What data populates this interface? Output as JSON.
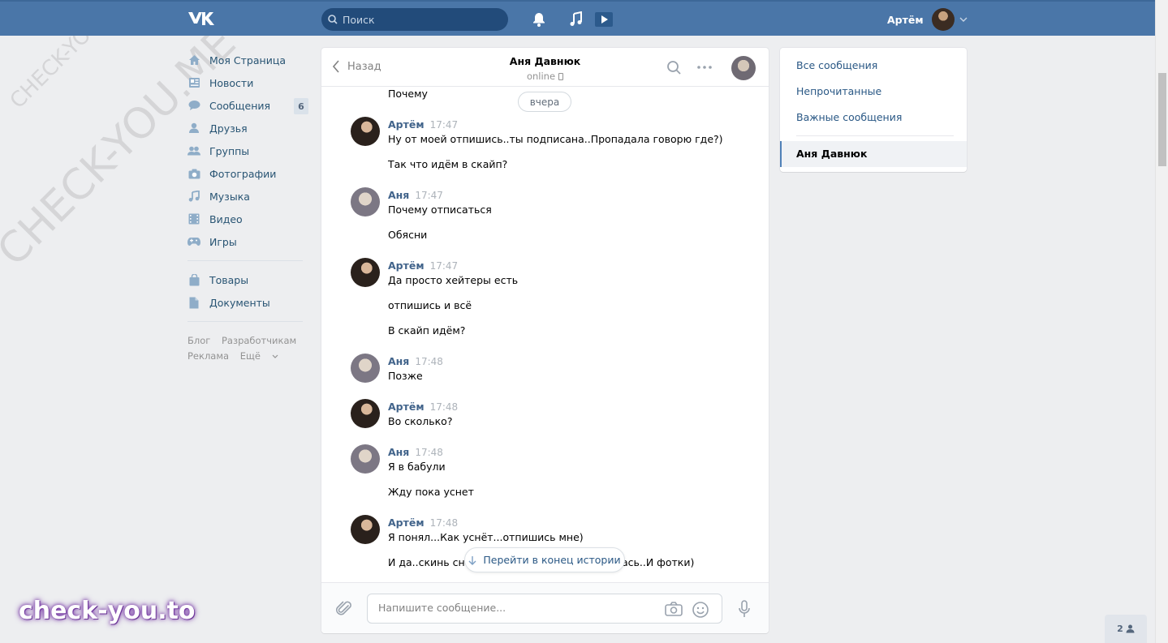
{
  "header": {
    "search_placeholder": "Поиск",
    "user_name": "Артём"
  },
  "nav": {
    "items": [
      {
        "label": "Моя Страница",
        "icon": "home-icon"
      },
      {
        "label": "Новости",
        "icon": "news-icon"
      },
      {
        "label": "Сообщения",
        "icon": "messages-icon",
        "badge": "6"
      },
      {
        "label": "Друзья",
        "icon": "friends-icon"
      },
      {
        "label": "Группы",
        "icon": "groups-icon"
      },
      {
        "label": "Фотографии",
        "icon": "camera-icon"
      },
      {
        "label": "Музыка",
        "icon": "music-icon"
      },
      {
        "label": "Видео",
        "icon": "video-icon"
      },
      {
        "label": "Игры",
        "icon": "gamepad-icon"
      }
    ],
    "items2": [
      {
        "label": "Товары",
        "icon": "bag-icon"
      },
      {
        "label": "Документы",
        "icon": "document-icon"
      }
    ],
    "footer": [
      "Блог",
      "Разработчикам",
      "Реклама",
      "Ещё"
    ]
  },
  "chat": {
    "back_label": "Назад",
    "title": "Аня Давнюк",
    "status": "online",
    "date_pill": "вчера",
    "top_partial": "Почему",
    "jump_label": "Перейти в конец истории",
    "input_placeholder": "Напишите сообщение...",
    "messages": [
      {
        "author": "Артём",
        "time": "17:47",
        "lines": [
          "Ну от моей отпишись..ты подписана..Пропадала говорю где?)",
          "Так что идём в скайп?"
        ]
      },
      {
        "author": "Аня",
        "time": "17:47",
        "lines": [
          "Почему отписаться",
          "Обясни"
        ]
      },
      {
        "author": "Артём",
        "time": "17:47",
        "lines": [
          "Да просто хейтеры есть",
          "отпишись и всё",
          "В скайп идём?"
        ]
      },
      {
        "author": "Аня",
        "time": "17:48",
        "lines": [
          "Позже"
        ]
      },
      {
        "author": "Артём",
        "time": "17:48",
        "lines": [
          "Во сколько?"
        ]
      },
      {
        "author": "Аня",
        "time": "17:48",
        "lines": [
          "Я в бабули",
          "Жду пока уснет"
        ]
      },
      {
        "author": "Артём",
        "time": "17:48",
        "lines": [
          "Я понял...Как уснёт...отпишись мне)",
          "И да..скинь сно",
          "ась..И фотки)"
        ]
      }
    ]
  },
  "right": {
    "items": [
      "Все сообщения",
      "Непрочитанные",
      "Важные сообщения"
    ],
    "active": "Аня Давнюк"
  },
  "watermark": {
    "small": "CHECK-YOU.ME",
    "large": "CHECK-YOU.ME",
    "brand": "check-you.to"
  },
  "friends_online": "2",
  "colors": {
    "header": "#4a76a8",
    "link": "#2a5885",
    "author": "#42648b",
    "background": "#edeef0"
  }
}
